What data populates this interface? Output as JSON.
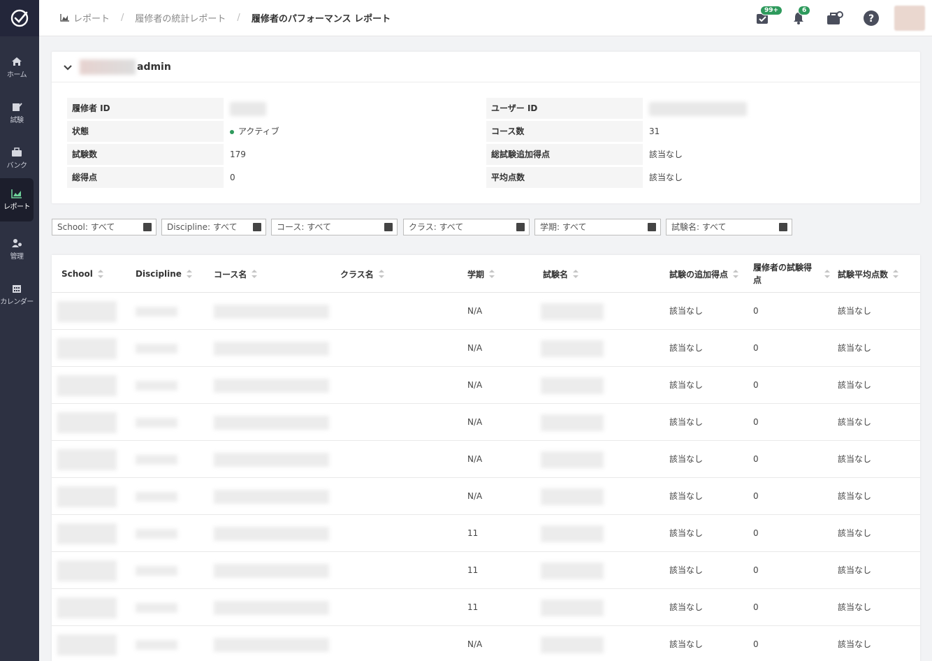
{
  "sidebar": {
    "items": [
      {
        "label": "ホーム",
        "icon": "home-icon"
      },
      {
        "label": "試験",
        "icon": "exam-icon"
      },
      {
        "label": "バンク",
        "icon": "bank-icon"
      },
      {
        "label": "レポート",
        "icon": "report-icon"
      },
      {
        "label": "管理",
        "icon": "admin-icon"
      },
      {
        "label": "カレンダー",
        "icon": "calendar-icon"
      }
    ]
  },
  "header": {
    "breadcrumb": [
      "レポート",
      "履修者の統計レポート",
      "履修者のパフォーマンス レポート"
    ],
    "tasks_badge": "99+",
    "notifications_badge": "6"
  },
  "profile": {
    "name_suffix": "admin",
    "fields_left": [
      {
        "label": "履修者 ID",
        "value": ""
      },
      {
        "label": "状態",
        "value": "アクティブ"
      },
      {
        "label": "試験数",
        "value": "179"
      },
      {
        "label": "総得点",
        "value": "0"
      }
    ],
    "fields_right": [
      {
        "label": "ユーザー ID",
        "value": ""
      },
      {
        "label": "コース数",
        "value": "31"
      },
      {
        "label": "総試験追加得点",
        "value": "該当なし"
      },
      {
        "label": "平均点数",
        "value": "該当なし"
      }
    ]
  },
  "filters": [
    "School: すべて",
    "Discipline: すべて",
    "コース: すべて",
    "クラス: すべて",
    "学期: すべて",
    "試験名: すべて"
  ],
  "table": {
    "columns": [
      "School",
      "Discipline",
      "コース名",
      "クラス名",
      "学期",
      "試験名",
      "試験の追加得点",
      "履修者の試験得点",
      "試験平均点数"
    ],
    "rows": [
      {
        "term": "N/A",
        "bonus": "該当なし",
        "score": "0",
        "avg": "該当なし"
      },
      {
        "term": "N/A",
        "bonus": "該当なし",
        "score": "0",
        "avg": "該当なし"
      },
      {
        "term": "N/A",
        "bonus": "該当なし",
        "score": "0",
        "avg": "該当なし"
      },
      {
        "term": "N/A",
        "bonus": "該当なし",
        "score": "0",
        "avg": "該当なし"
      },
      {
        "term": "N/A",
        "bonus": "該当なし",
        "score": "0",
        "avg": "該当なし"
      },
      {
        "term": "N/A",
        "bonus": "該当なし",
        "score": "0",
        "avg": "該当なし"
      },
      {
        "term": "11",
        "bonus": "該当なし",
        "score": "0",
        "avg": "該当なし"
      },
      {
        "term": "11",
        "bonus": "該当なし",
        "score": "0",
        "avg": "該当なし"
      },
      {
        "term": "11",
        "bonus": "該当なし",
        "score": "0",
        "avg": "該当なし"
      },
      {
        "term": "N/A",
        "bonus": "該当なし",
        "score": "0",
        "avg": "該当なし"
      }
    ]
  },
  "colors": {
    "sidebar": "#2d3142",
    "accent": "#2e9a5c"
  }
}
